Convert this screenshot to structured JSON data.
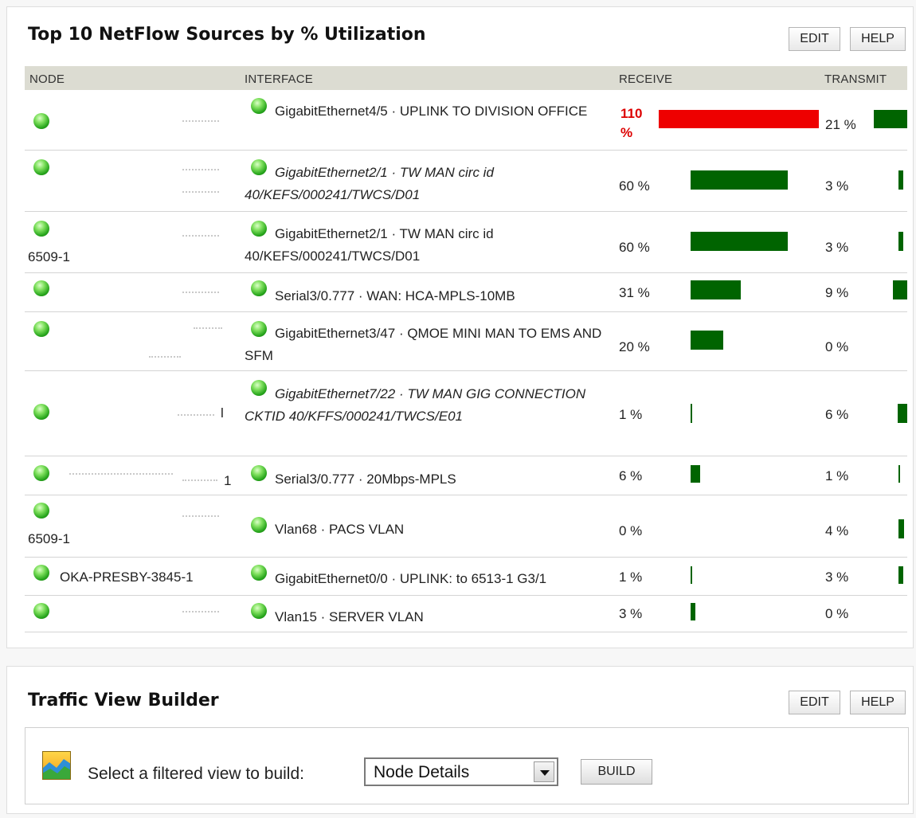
{
  "netflow": {
    "title": "Top 10 NetFlow Sources by % Utilization",
    "edit_label": "EDIT",
    "help_label": "HELP",
    "columns": {
      "node": "NODE",
      "interface": "INTERFACE",
      "receive": "RECEIVE",
      "transmit": "TRANSMIT"
    },
    "colors": {
      "bar": "#006400",
      "bar_over": "#ee0000",
      "over_text": "#dd0000",
      "header_bg": "#dcdcd2"
    },
    "rows": [
      {
        "node": "",
        "interface": "GigabitEthernet4/5 · UPLINK TO DIVISION OFFICE",
        "receive": "110 %",
        "receive_value": 110,
        "transmit": "21 %",
        "transmit_value": 21
      },
      {
        "node": "",
        "interface": "GigabitEthernet2/1 · TW MAN circ id 40/KEFS/000241/TWCS/D01",
        "receive": "60 %",
        "receive_value": 60,
        "transmit": "3 %",
        "transmit_value": 3
      },
      {
        "node": "6509-1",
        "interface": "GigabitEthernet2/1 · TW MAN circ id 40/KEFS/000241/TWCS/D01",
        "receive": "60 %",
        "receive_value": 60,
        "transmit": "3 %",
        "transmit_value": 3
      },
      {
        "node": "",
        "interface": "Serial3/0.777 · WAN: HCA-MPLS-10MB",
        "receive": "31 %",
        "receive_value": 31,
        "transmit": "9 %",
        "transmit_value": 9
      },
      {
        "node": "",
        "interface": "GigabitEthernet3/47 · QMOE MINI MAN TO EMS AND SFM",
        "receive": "20 %",
        "receive_value": 20,
        "transmit": "0 %",
        "transmit_value": 0
      },
      {
        "node": "l",
        "interface": "GigabitEthernet7/22 · TW MAN GIG CONNECTION CKTID 40/KFFS/000241/TWCS/E01",
        "receive": "1 %",
        "receive_value": 1,
        "transmit": "6 %",
        "transmit_value": 6
      },
      {
        "node": "1",
        "interface": "Serial3/0.777 · 20Mbps-MPLS",
        "receive": "6 %",
        "receive_value": 6,
        "transmit": "1 %",
        "transmit_value": 1
      },
      {
        "node": "6509-1",
        "interface": "Vlan68 · PACS VLAN",
        "receive": "0 %",
        "receive_value": 0,
        "transmit": "4 %",
        "transmit_value": 4
      },
      {
        "node": "OKA-PRESBY-3845-1",
        "interface": "GigabitEthernet0/0 · UPLINK: to 6513-1 G3/1",
        "receive": "1 %",
        "receive_value": 1,
        "transmit": "3 %",
        "transmit_value": 3
      },
      {
        "node": "",
        "interface": "Vlan15 · SERVER VLAN",
        "receive": "3 %",
        "receive_value": 3,
        "transmit": "0 %",
        "transmit_value": 0
      }
    ]
  },
  "traffic_view_builder": {
    "title": "Traffic View Builder",
    "edit_label": "EDIT",
    "help_label": "HELP",
    "prompt": "Select a filtered view to build:",
    "selected_view": "Node Details",
    "build_label": "BUILD",
    "icon": "chart-icon"
  }
}
